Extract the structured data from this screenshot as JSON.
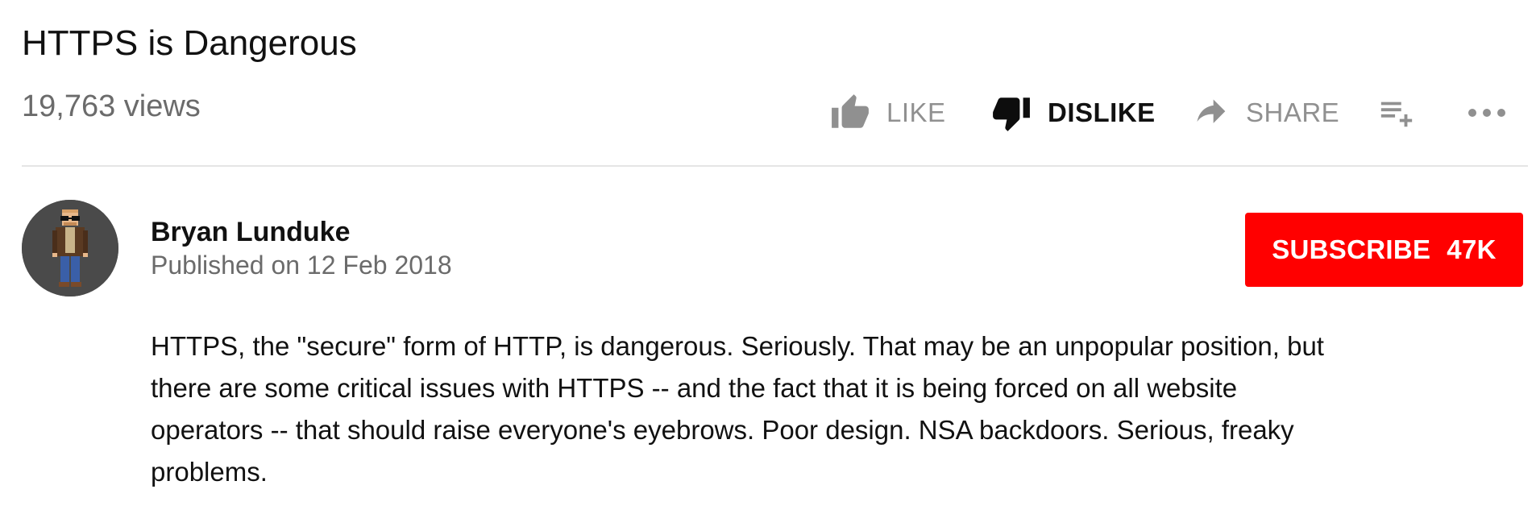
{
  "video": {
    "title": "HTTPS is Dangerous",
    "views": "19,763 views"
  },
  "actions": {
    "like_label": "LIKE",
    "dislike_label": "DISLIKE",
    "share_label": "SHARE",
    "like_icon": "thumbs-up-icon",
    "dislike_icon": "thumbs-down-icon",
    "share_icon": "share-arrow-icon",
    "add_to_icon": "playlist-add-icon",
    "more_icon": "more-horizontal-icon",
    "dislike_active": true
  },
  "channel": {
    "name": "Bryan Lunduke",
    "published": "Published on 12 Feb 2018",
    "avatar_icon": "pixel-art-avatar"
  },
  "subscribe": {
    "label": "SUBSCRIBE",
    "count": "47K",
    "color": "#ff0000"
  },
  "description": {
    "text": "HTTPS, the \"secure\" form of HTTP, is dangerous.  Seriously.  That may be an unpopular position, but\nthere are some critical issues with HTTPS -- and the fact that it is being forced on all website\noperators -- that should raise everyone's eyebrows.  Poor design.  NSA backdoors.  Serious, freaky\nproblems."
  },
  "colors": {
    "muted": "#909090",
    "text": "#111111",
    "subtle_text": "#6b6b6b",
    "divider": "#e5e5e5"
  }
}
